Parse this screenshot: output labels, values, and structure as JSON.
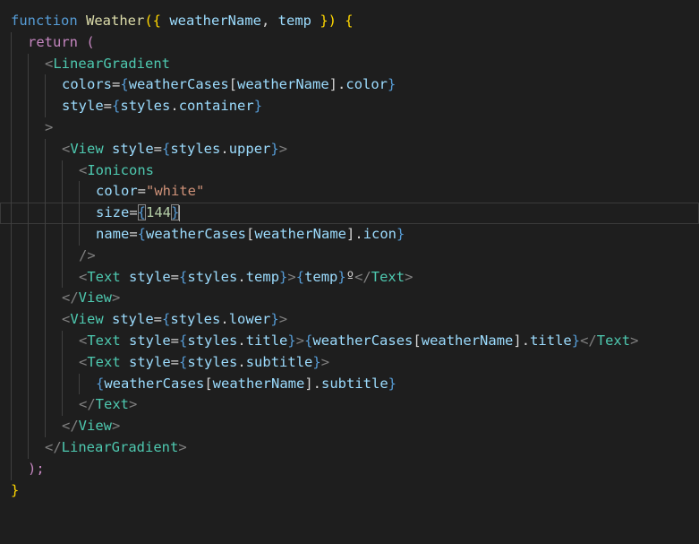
{
  "editor": {
    "lines": {
      "l1": {
        "kw_function": "function",
        "fn_name": "Weather",
        "open": "({ ",
        "p1": "weatherName",
        "comma": ", ",
        "p2": "temp",
        "close": " }) {"
      },
      "l2": {
        "kw_return": "return",
        "paren": " ("
      },
      "l3": {
        "lt": "<",
        "tag": "LinearGradient"
      },
      "l4": {
        "attr": "colors",
        "eq": "=",
        "ob": "{",
        "obj": "weatherCases",
        "lb": "[",
        "key": "weatherName",
        "rb": "]",
        "dot": ".",
        "prop": "color",
        "cb": "}"
      },
      "l5": {
        "attr": "style",
        "eq": "=",
        "ob": "{",
        "obj": "styles",
        "dot": ".",
        "prop": "container",
        "cb": "}"
      },
      "l6": {
        "gt": ">"
      },
      "l7": {
        "lt": "<",
        "tag": "View",
        "attr": " style",
        "eq": "=",
        "ob": "{",
        "obj": "styles",
        "dot": ".",
        "prop": "upper",
        "cb": "}",
        "gt": ">"
      },
      "l8": {
        "lt": "<",
        "tag": "Ionicons"
      },
      "l9": {
        "attr": "color",
        "eq": "=",
        "str": "\"white\""
      },
      "l10": {
        "attr": "size",
        "eq": "=",
        "ob": "{",
        "num": "144",
        "cb": "}"
      },
      "l11": {
        "attr": "name",
        "eq": "=",
        "ob": "{",
        "obj": "weatherCases",
        "lb": "[",
        "key": "weatherName",
        "rb": "]",
        "dot": ".",
        "prop": "icon",
        "cb": "}"
      },
      "l12": {
        "selfclose": "/>"
      },
      "l13": {
        "lt": "<",
        "tag": "Text",
        "attr": " style",
        "eq": "=",
        "ob": "{",
        "obj": "styles",
        "dot": ".",
        "prop": "temp",
        "cb": "}",
        "gt": ">",
        "ob2": "{",
        "var": "temp",
        "cb2": "}",
        "deg": "º",
        "lt2": "</",
        "tag2": "Text",
        "gt2": ">"
      },
      "l14": {
        "lt": "</",
        "tag": "View",
        "gt": ">"
      },
      "l15": {
        "lt": "<",
        "tag": "View",
        "attr": " style",
        "eq": "=",
        "ob": "{",
        "obj": "styles",
        "dot": ".",
        "prop": "lower",
        "cb": "}",
        "gt": ">"
      },
      "l16": {
        "lt": "<",
        "tag": "Text",
        "attr": " style",
        "eq": "=",
        "ob": "{",
        "obj": "styles",
        "dot": ".",
        "prop": "title",
        "cb": "}",
        "gt": ">",
        "ob2": "{",
        "obj2": "weatherCases",
        "lb": "[",
        "key": "weatherName",
        "rb": "]",
        "dot2": ".",
        "prop2": "title",
        "cb2": "}",
        "lt2": "</",
        "tag2": "Text",
        "gt2": ">"
      },
      "l17": {
        "lt": "<",
        "tag": "Text",
        "attr": " style",
        "eq": "=",
        "ob": "{",
        "obj": "styles",
        "dot": ".",
        "prop": "subtitle",
        "cb": "}",
        "gt": ">"
      },
      "l18": {
        "ob": "{",
        "obj": "weatherCases",
        "lb": "[",
        "key": "weatherName",
        "rb": "]",
        "dot": ".",
        "prop": "subtitle",
        "cb": "}"
      },
      "l19": {
        "lt": "</",
        "tag": "Text",
        "gt": ">"
      },
      "l20": {
        "lt": "</",
        "tag": "View",
        "gt": ">"
      },
      "l21": {
        "lt": "</",
        "tag": "LinearGradient",
        "gt": ">"
      },
      "l22": {
        "text": ");"
      },
      "l23": {
        "text": "}"
      }
    }
  },
  "colors": {
    "background": "#1e1e1e",
    "keyword": "#569cd6",
    "control": "#c586c0",
    "function": "#dcdcaa",
    "variable": "#9cdcfe",
    "tag": "#4ec9b0",
    "string": "#ce9178",
    "number": "#b5cea8",
    "punctuation": "#808080"
  }
}
